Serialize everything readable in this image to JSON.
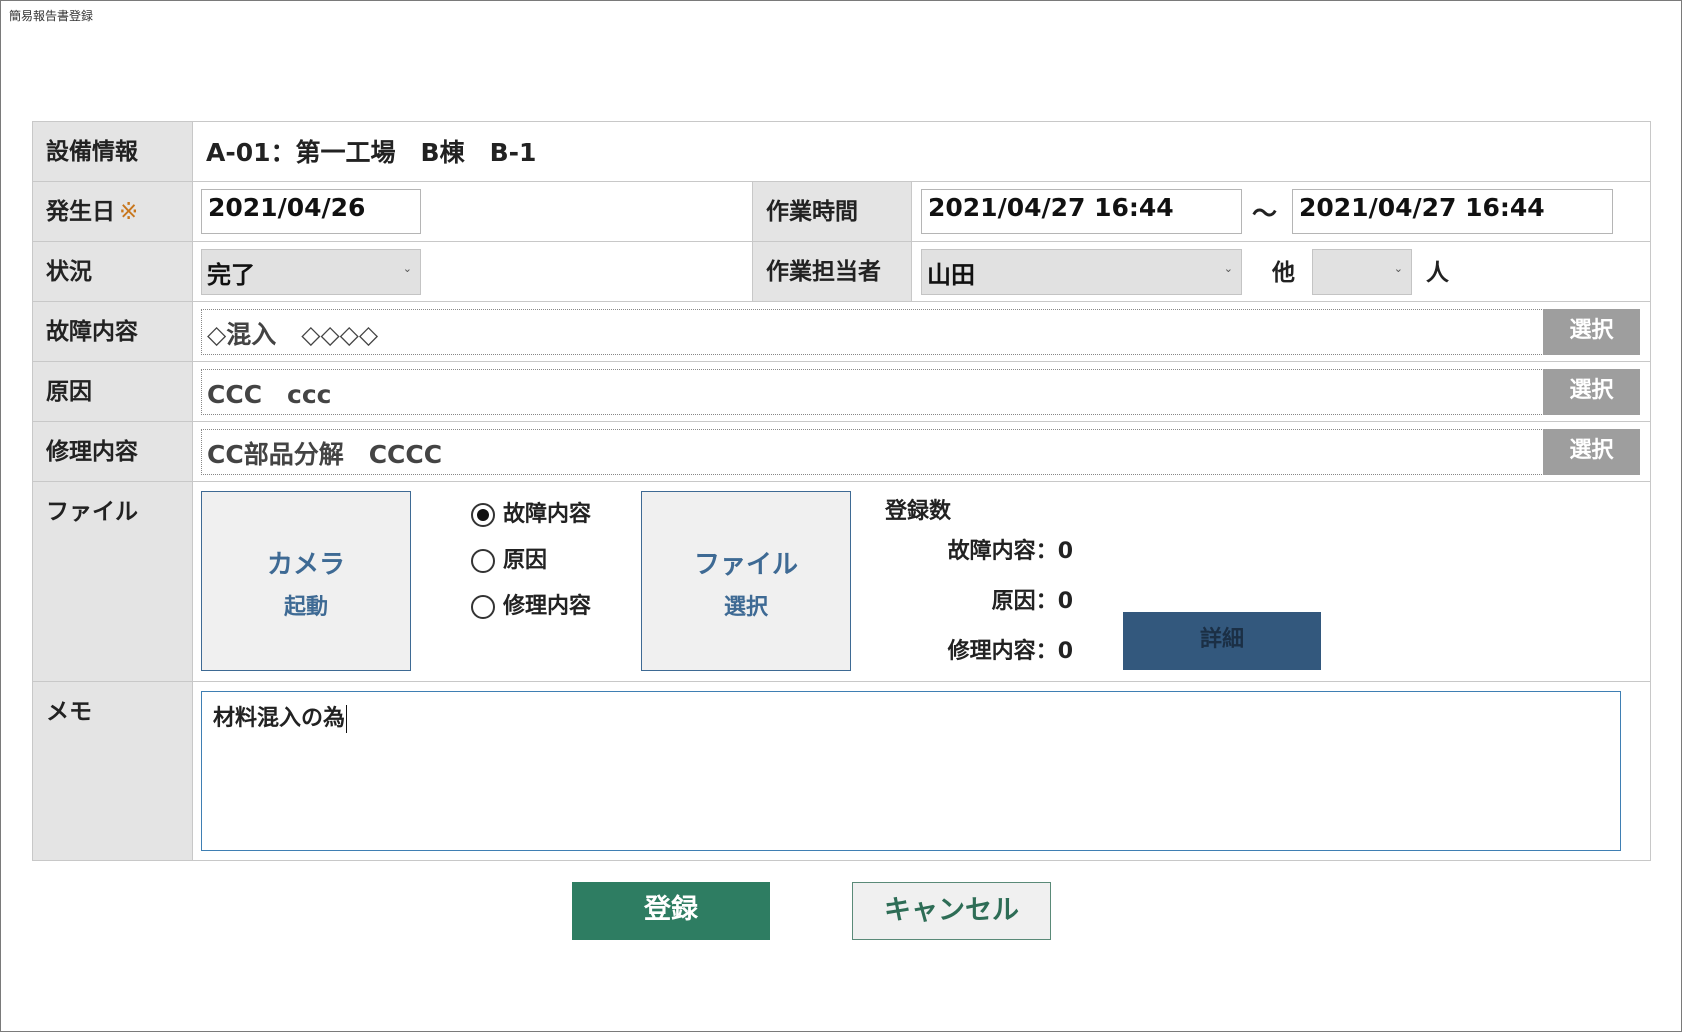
{
  "window": {
    "title": "簡易報告書登録"
  },
  "equipment": {
    "label": "設備情報",
    "value": "A-01：第一工場　B棟　B-1"
  },
  "occurrence": {
    "label": "発生日",
    "required_mark": "※",
    "value": "2021/04/26"
  },
  "work_time": {
    "label": "作業時間",
    "start": "2021/04/27 16:44",
    "separator": "～",
    "end": "2021/04/27 16:44"
  },
  "status": {
    "label": "状況",
    "value": "完了"
  },
  "worker": {
    "label": "作業担当者",
    "value": "山田",
    "others_label": "他",
    "others_value": "",
    "unit_label": "人"
  },
  "fault": {
    "label": "故障内容",
    "value": "◇混入　◇◇◇◇",
    "button": "選択"
  },
  "cause": {
    "label": "原因",
    "value": "CCC　ccc",
    "button": "選択"
  },
  "repair": {
    "label": "修理内容",
    "value": "CC部品分解　CCCC",
    "button": "選択"
  },
  "file": {
    "label": "ファイル",
    "camera_line1": "カメラ",
    "camera_line2": "起動",
    "radio": [
      {
        "label": "故障内容",
        "selected": true
      },
      {
        "label": "原因",
        "selected": false
      },
      {
        "label": "修理内容",
        "selected": false
      }
    ],
    "select_line1": "ファイル",
    "select_line2": "選択",
    "count_title": "登録数",
    "counts": [
      {
        "label": "故障内容：",
        "value": "0"
      },
      {
        "label": "原因：",
        "value": "0"
      },
      {
        "label": "修理内容：",
        "value": "0"
      }
    ],
    "detail_button": "詳細"
  },
  "memo": {
    "label": "メモ",
    "value": "材料混入の為"
  },
  "actions": {
    "register": "登録",
    "cancel": "キャンセル"
  }
}
